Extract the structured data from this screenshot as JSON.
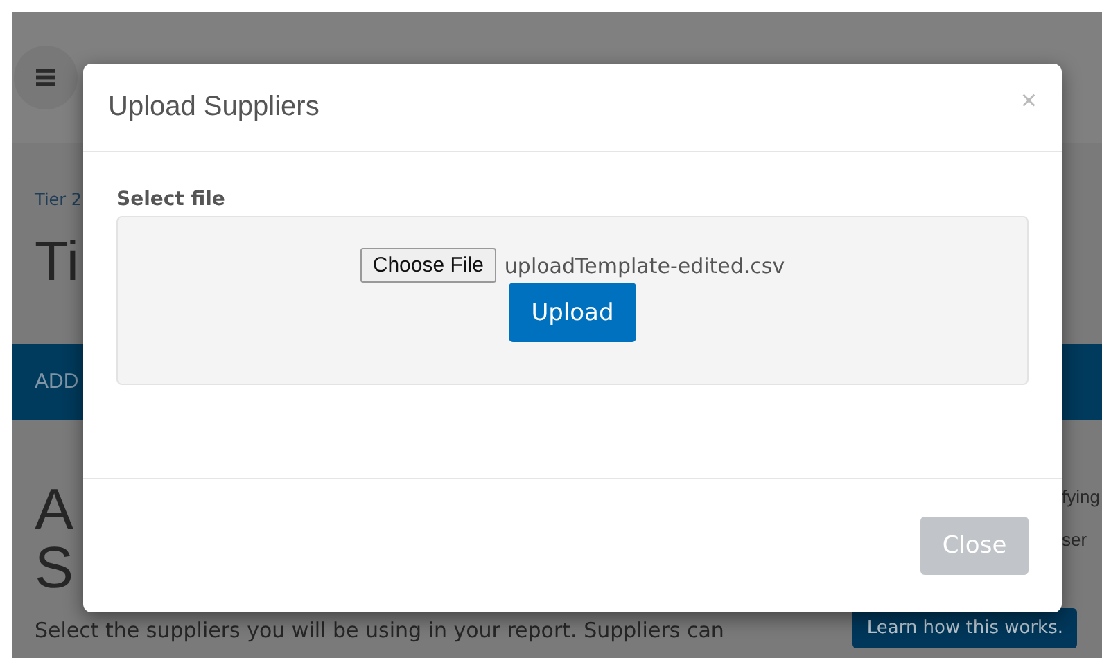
{
  "page": {
    "breadcrumb": "Tier 2",
    "title": "Ti",
    "banner": "ADD",
    "heading": [
      "A",
      "S"
    ],
    "side_texts": [
      "fying",
      "ser"
    ],
    "paragraph": "Select the suppliers you will be using in your report. Suppliers can",
    "help_button": "Learn how this works."
  },
  "modal": {
    "title": "Upload Suppliers",
    "close_icon": "×",
    "label": "Select file",
    "file_button": "Choose File",
    "file_name": "uploadTemplate-edited.csv",
    "upload_button": "Upload",
    "close_button": {
      "label": "Close",
      "disabled": true
    }
  }
}
